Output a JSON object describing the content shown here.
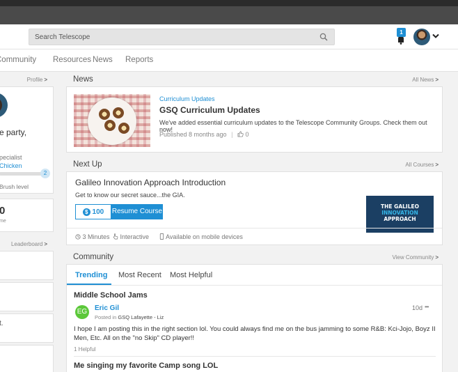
{
  "header": {
    "search_placeholder": "Search Telescope",
    "notification_count": "1"
  },
  "nav": {
    "items": [
      "Community",
      "Resources",
      "News",
      "Reports"
    ]
  },
  "left": {
    "profile_link": "Profile",
    "greeting": "e party,",
    "role": "pecialist",
    "team": "Chicken",
    "level_count": "2",
    "level_text": "Brush level",
    "points_value": "0",
    "points_label": "me",
    "leaderboard_link": "Leaderboard",
    "snippet": "t."
  },
  "news": {
    "title": "News",
    "all_link": "All News",
    "category": "Curriculum Updates",
    "headline": "GSQ Curriculum Updates",
    "body": "We've added essential curriculum updates to the Telescope Community Groups. Check them out now!",
    "meta": "Published 8 months ago",
    "likes": "0"
  },
  "next_up": {
    "title": "Next Up",
    "all_link": "All Courses",
    "course_title": "Galileo Innovation Approach Introduction",
    "course_desc": "Get to know our secret sauce...the GIA.",
    "price": "100",
    "resume_label": "Resume Course",
    "image_text": [
      "THE GALILEO",
      "INNOVATION",
      "APPROACH"
    ],
    "features": [
      "3 Minutes",
      "Interactive",
      "Available on mobile devices"
    ]
  },
  "community": {
    "title": "Community",
    "view_link": "View Community",
    "tabs": [
      "Trending",
      "Most Recent",
      "Most Helpful"
    ],
    "post_title": "Middle School Jams",
    "author_initials": "EG",
    "author": "Eric Gil",
    "posted_prefix": "Posted in",
    "group": "GSQ Lafayette - Liz",
    "age": "10d",
    "more": "•••",
    "post_body": "I hope I am posting this in the right section lol. You could always find me on the bus jamming to some R&B: Kci-Jojo, Boyz II Men, Etc. All on the \"no Skip\" CD player!!",
    "helpful": "1 Helpful",
    "next_post_title": "Me singing my favorite Camp song LOL"
  },
  "colors": {
    "accent": "#1f8fd4",
    "avatar_green": "#5cc83a"
  }
}
